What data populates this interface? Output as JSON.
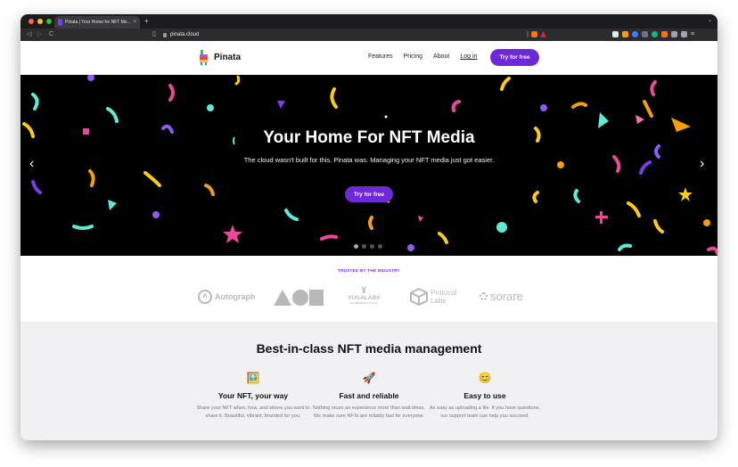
{
  "browser": {
    "tab_title": "Pinata | Your Home for NFT Me...",
    "tab_close": "×",
    "new_tab": "+",
    "url": "pinata.cloud",
    "back": "◁",
    "forward": "▷",
    "reload": "C"
  },
  "header": {
    "brand": "Pinata",
    "nav": [
      {
        "label": "Features"
      },
      {
        "label": "Pricing"
      },
      {
        "label": "About"
      },
      {
        "label": "Log in"
      }
    ],
    "cta": "Try for free"
  },
  "hero": {
    "title": "Your Home For NFT Media",
    "subtitle": "The cloud wasn't built for this. Pinata was. Managing your NFT media just got easier.",
    "cta": "Try for free",
    "prev": "‹",
    "next": "›",
    "slide_count": 4,
    "active_slide": 1
  },
  "trusted": {
    "label": "TRUSTED BY THE INDUSTRY",
    "logos": {
      "autograph": "Autograph",
      "yuga": "YUGALABS",
      "yuga_small": "IN UNISON W/ ★★★ ★★",
      "protocol": "Protocol",
      "labs": "Labs",
      "sorare": "sorare"
    }
  },
  "features": {
    "title": "Best-in-class NFT media management",
    "items": [
      {
        "icon": "🖼️",
        "title": "Your NFT, your way",
        "text": "Share your NFT when, how, and where you want to share it. Beautiful, vibrant, branded for you."
      },
      {
        "icon": "🚀",
        "title": "Fast and reliable",
        "text": "Nothing sours an experience more than wait times. We make sure NFTs are reliably fast for everyone."
      },
      {
        "icon": "😊",
        "title": "Easy to use",
        "text": "As easy as uploading a file. If you have questions, our support team can help you succeed."
      }
    ]
  },
  "colors": {
    "accent": "#6d28d9",
    "hero_bg": "#000000",
    "features_bg": "#f1f1f4"
  }
}
